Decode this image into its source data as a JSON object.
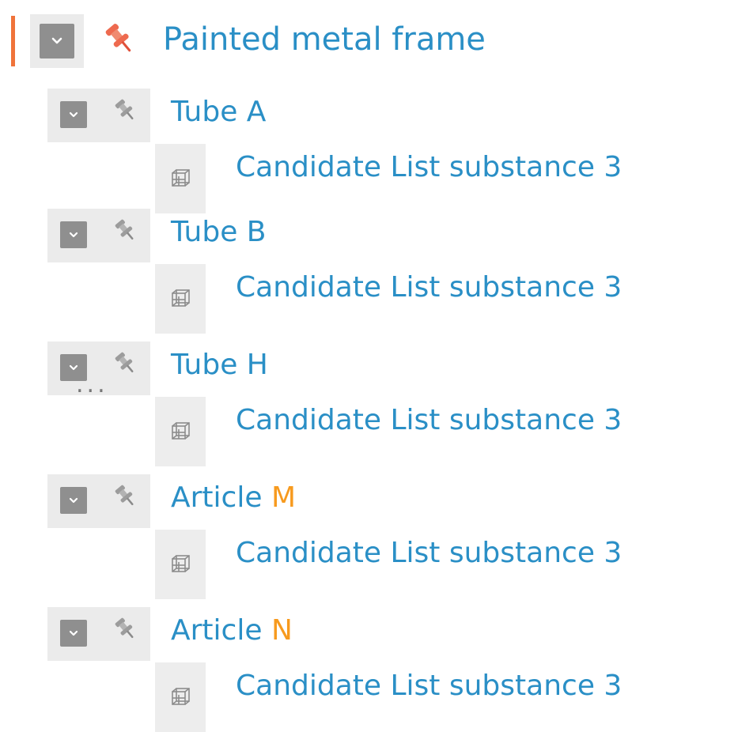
{
  "tree": {
    "root": {
      "label": "Painted metal frame",
      "icon": "pushpin-icon",
      "accent_color": "#f0733a"
    },
    "items": [
      {
        "label": "Tube A",
        "suffix": "",
        "child": "Candidate List substance 3"
      },
      {
        "label": "Tube B",
        "suffix": "",
        "child": "Candidate List substance 3"
      },
      {
        "label": "Tube H",
        "suffix": "",
        "child": "Candidate List substance 3"
      },
      {
        "label": "Article ",
        "suffix": "M",
        "child": "Candidate List substance 3"
      },
      {
        "label": "Article ",
        "suffix": "N",
        "child": "Candidate List substance 3"
      }
    ],
    "ellipsis": "...",
    "colors": {
      "link": "#2a8fc6",
      "highlight": "#f79a1e",
      "toggle": "#8f8f8f"
    }
  }
}
